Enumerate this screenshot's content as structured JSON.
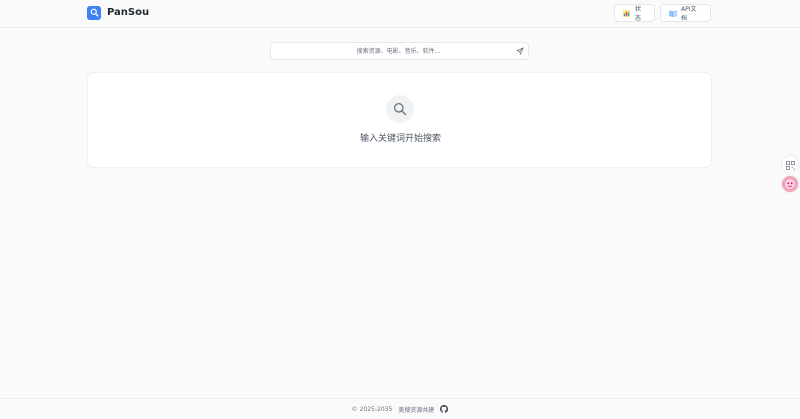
{
  "header": {
    "brand": "PanSou",
    "status_label": "状态",
    "api_label": "API文档"
  },
  "search": {
    "placeholder": "搜索资源、电影、音乐、软件..."
  },
  "empty_state": {
    "message": "输入关键词开始搜索"
  },
  "footer": {
    "copyright": "© 2025-2035",
    "slogan": "美搜资源共建"
  },
  "icons": {
    "logo": "search-icon",
    "status": "bar-chart-icon",
    "api": "book-icon",
    "send": "send-icon",
    "empty": "search-icon",
    "qr": "qr-code-icon",
    "mascot": "mascot-icon",
    "github": "github-icon"
  },
  "colors": {
    "brand": "#3b82f6",
    "background": "#fafafa",
    "card": "#ffffff",
    "mascot": "#f3a3b7"
  }
}
